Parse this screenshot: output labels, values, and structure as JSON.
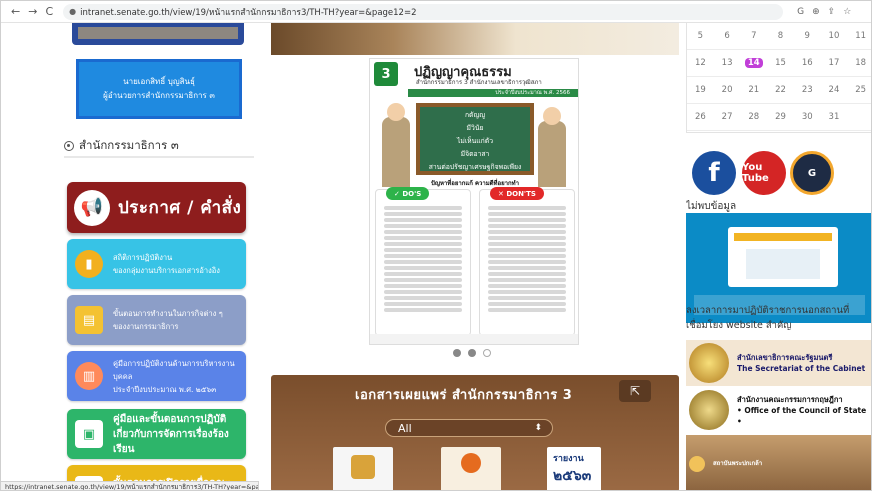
{
  "browser": {
    "url": "intranet.senate.go.th/view/19/หน้าแรกสำนักกรมาธิการ3/TH-TH?year=&page12=2",
    "status_url": "https://intranet.senate.go.th/view/19/หน้าแรกสำนักกรมาธิการ3/TH-TH?year=&page12=2"
  },
  "left": {
    "director_line1": "นายเอกสิทธิ์ บุญสินธุ์",
    "director_line2": "ผู้อำนวยการสำนักกรรมาธิการ ๓",
    "section_title": "สำนักกรรมาธิการ ๓",
    "announce_label": "ประกาศ / คำสั่ง",
    "btn1_line1": "สถิติการปฏิบัติงาน",
    "btn1_line2": "ของกลุ่มงานบริการเอกสารอ้างอิง",
    "btn2_line1": "ขั้นตอนการทำงานในภารกิจต่าง ๆ",
    "btn2_line2": "ของงานกรรมาธิการ",
    "btn3_line1": "คู่มือการปฏิบัติงานด้านการบริหารงานบุคคล",
    "btn3_line2": "ประจำปีงบประมาณ พ.ศ. ๒๕๖๓",
    "btn4_line1": "คู่มือและขั้นตอนการปฏิบัติ",
    "btn4_line2": "เกี่ยวกับการจัดการเรื่องร้องเรียน",
    "btn5_line1": "ขั้นตอนการเปิดรายชื่อคณะกรรมาธิการ"
  },
  "center": {
    "poster": {
      "number": "3",
      "title": "ปฏิญญาคุณธรรม",
      "subtitle": "สำนักกรรมาธิการ 3 สำนักงานเลขาธิการวุฒิสภา",
      "fiscal_year": "ประจำปีงบประมาณ พ.ศ. 2566",
      "board": [
        "กตัญญู",
        "มีวินัย",
        "ไม่เห็นแก่ตัว",
        "มีจิตอาสา",
        "สานต่อปรัชญาเศรษฐกิจพอเพียง"
      ],
      "problem": "ปัญหาที่อยากแก้ ความดีที่อยากทำ",
      "dos_label": "DO'S",
      "donts_label": "DON'TS"
    },
    "docs_title": "เอกสารเผยแพร่ สำนักกรรมาธิการ 3",
    "docs_filter": "All",
    "book3_line1": "รายงาน",
    "book3_line2": "๒๕๖๓"
  },
  "right": {
    "calendar_rows": [
      [
        "5",
        "6",
        "7",
        "8",
        "9",
        "10",
        "11"
      ],
      [
        "12",
        "13",
        "14",
        "15",
        "16",
        "17",
        "18"
      ],
      [
        "19",
        "20",
        "21",
        "22",
        "23",
        "24",
        "25"
      ],
      [
        "26",
        "27",
        "28",
        "29",
        "30",
        "31",
        ""
      ]
    ],
    "today": "14",
    "yt_label": "You Tube",
    "heading": "ไม่พบข้อมูล",
    "text1": "ลงเวลาการมาปฏิบัติราชการนอกสถานที่",
    "text2": "เชื่อมโยง website สำคัญ",
    "card1_line1": "สำนักเลขาธิการคณะรัฐมนตรี",
    "card1_line2": "The Secretariat of the Cabinet",
    "card2_line1": "สำนักงานคณะกรรมการกฤษฎีกา",
    "card2_line2": "• Office of the Council of State •",
    "card3_line1": "สถาบันพระปกเกล้า"
  }
}
